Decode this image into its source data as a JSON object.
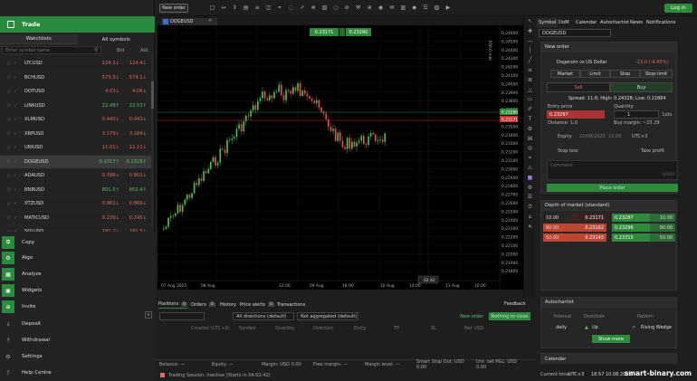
{
  "topbar": {
    "new_order": "New order",
    "login": "Log in"
  },
  "left": {
    "trade": "Trade",
    "tabs": [
      "Watchlists",
      "All symbols"
    ],
    "search_placeholder": "Enter symbol name",
    "col_bid": "Bid",
    "col_ask": "Ask"
  },
  "symbols": [
    {
      "name": "LTCUSD",
      "bid": "124.1↓",
      "ask": "124.4↓",
      "dir": "down"
    },
    {
      "name": "BCHUSD",
      "bid": "573.3↓",
      "ask": "574.1↓",
      "dir": "down"
    },
    {
      "name": "DOTUSD",
      "bid": "4.03↓",
      "ask": "4.06↓",
      "dir": "down"
    },
    {
      "name": "LINKUSD",
      "bid": "22.48↑",
      "ask": "22.53↑",
      "dir": "up"
    },
    {
      "name": "XLMUSD",
      "bid": "0.440↓",
      "ask": "0.443↓",
      "dir": "down"
    },
    {
      "name": "XRPUSD",
      "bid": "3.179↓",
      "ask": "3.184↓",
      "dir": "down"
    },
    {
      "name": "UNIUSD",
      "bid": "11.01↓",
      "ask": "11.11↓",
      "dir": "down"
    },
    {
      "name": "DOGEUSD",
      "bid": "0.2317↑",
      "ask": "0.2328↑",
      "dir": "up"
    },
    {
      "name": "ADAUSD",
      "bid": "0.786↓",
      "ask": "0.802↓",
      "dir": "down"
    },
    {
      "name": "BNBUSD",
      "bid": "801.5↑",
      "ask": "802.4↑",
      "dir": "up"
    },
    {
      "name": "XTZUSD",
      "bid": "0.861↓",
      "ask": "0.866↓",
      "dir": "down"
    },
    {
      "name": "MATICUSD",
      "bid": "0.239↓",
      "ask": "0.245↓",
      "dir": "down"
    },
    {
      "name": "SOLUSD",
      "bid": "181.2↓",
      "ask": "181.5↓",
      "dir": "down"
    }
  ],
  "menu": [
    "Copy",
    "Algo",
    "Analyze",
    "Widgets",
    "Invite",
    "Deposit",
    "Withdrawal",
    "Settings",
    "Help Centre"
  ],
  "chart": {
    "symbol": "DOGEUSD",
    "bid_box": "0.23171",
    "ask_box": "0.23280",
    "volume": "100.0 min",
    "time_labels": [
      "07 Aug 2025",
      "08 Aug",
      "12:00",
      "09 Aug",
      "18:00",
      "10 Aug",
      "14:00",
      "11 Aug",
      "10:00"
    ],
    "cursor_time": "02:42",
    "price_labels": [
      "0.24600",
      "0.24500",
      "0.24400",
      "0.24300",
      "0.24200",
      "0.24100",
      "0.24000",
      "0.23900",
      "0.23800",
      "0.23700",
      "0.23600",
      "0.23500",
      "0.23400",
      "0.23300",
      "0.23200",
      "0.23100",
      "0.23000",
      "0.22900",
      "0.22800",
      "0.22700",
      "0.22600",
      "0.22500",
      "0.22400",
      "0.22300",
      "0.22200",
      "0.22100",
      "0.22000",
      "0.21900",
      "0.21800"
    ],
    "price_tag_ask": "0.23280",
    "price_tag_bid": "0.23171"
  },
  "bottom": {
    "tabs": [
      {
        "label": "Positions",
        "count": "0"
      },
      {
        "label": "Orders",
        "count": "0"
      },
      {
        "label": "History",
        "count": ""
      },
      {
        "label": "Price alerts",
        "count": "0"
      },
      {
        "label": "Transactions",
        "count": ""
      }
    ],
    "feedback": "Feedback",
    "dir_filter": "All directions (default)",
    "agg_filter": "Not aggregated (default)",
    "new_order": "New order",
    "nothing": "Nothing to close",
    "columns": [
      "Created (UTC+3)",
      "Symbol",
      "Quantity",
      "Direction",
      "Entry",
      "TP",
      "SL",
      "Net USD"
    ],
    "status": {
      "balance": "Balance: —",
      "equity": "Equity: —",
      "margin": "Margin: USD 0.00",
      "free_margin": "Free margin: —",
      "margin_level": "Margin level: —",
      "smart_stop": "Smart Stop Out: USD 0.00",
      "unr": "Unr. net P&L: USD 0.00"
    },
    "session": "Trading Session: Inactive (Starts in 04:02:42)"
  },
  "right": {
    "tabs": [
      "Symbol",
      "DoM",
      "Calendar",
      "Autochartist",
      "News",
      "Notifications"
    ],
    "symbol": "DOGEUSD",
    "new_order": "New order",
    "pair": "Dogecoin vs US Dollar",
    "change": "-13.0 (-4.45%)",
    "order_types": [
      "Market",
      "Limit",
      "Stop",
      "Stop-limit"
    ],
    "sell": "Sell",
    "buy": "Buy",
    "spread": "Spread: 11.6; High: 0.24328; Low: 0.22884",
    "entry_label": "Entry price",
    "entry_value": "0.23297",
    "quantity_label": "Quantity",
    "quantity_value": "1",
    "lots": "Lots",
    "distance": "Distance: 1.0",
    "buy_margin": "Buy margin: ~23.29",
    "expiry": "Expiry",
    "expiry_date": "10/08/2025",
    "expiry_time": "19:00",
    "tz": "UTC+3",
    "stop_loss": "Stop loss",
    "take_profit": "Take profit",
    "comment_placeholder": "Comment",
    "comment_count": "0/100",
    "place_order": "Place order",
    "dom_title": "Depth of market (standard)",
    "dom": [
      {
        "qty": "10.00",
        "sell": "0.23171",
        "buy": "0.23287",
        "bqty": "10.00"
      },
      {
        "qty": "90.00",
        "sell": "0.23162",
        "buy": "0.23296",
        "bqty": "90.00"
      },
      {
        "qty": "50.00",
        "sell": "0.23143",
        "buy": "0.23315",
        "bqty": "50.00"
      }
    ],
    "autochartist": "Autochartist",
    "ac_cols": [
      "Interval",
      "Direction",
      "Pattern"
    ],
    "ac_interval": "daily",
    "ac_dir": "Up",
    "ac_pattern": "Rising Wedge",
    "show_more": "Show more",
    "calendar": "Calendar",
    "current_time_label": "Current time:",
    "tz2": "UTC+3",
    "current_time": "18:57 10.08.2025"
  },
  "watermark": "smart-binary.com",
  "colors": {
    "green": "#2e8b3c",
    "red": "#e36a5a",
    "bg": "#1e1e1e"
  }
}
